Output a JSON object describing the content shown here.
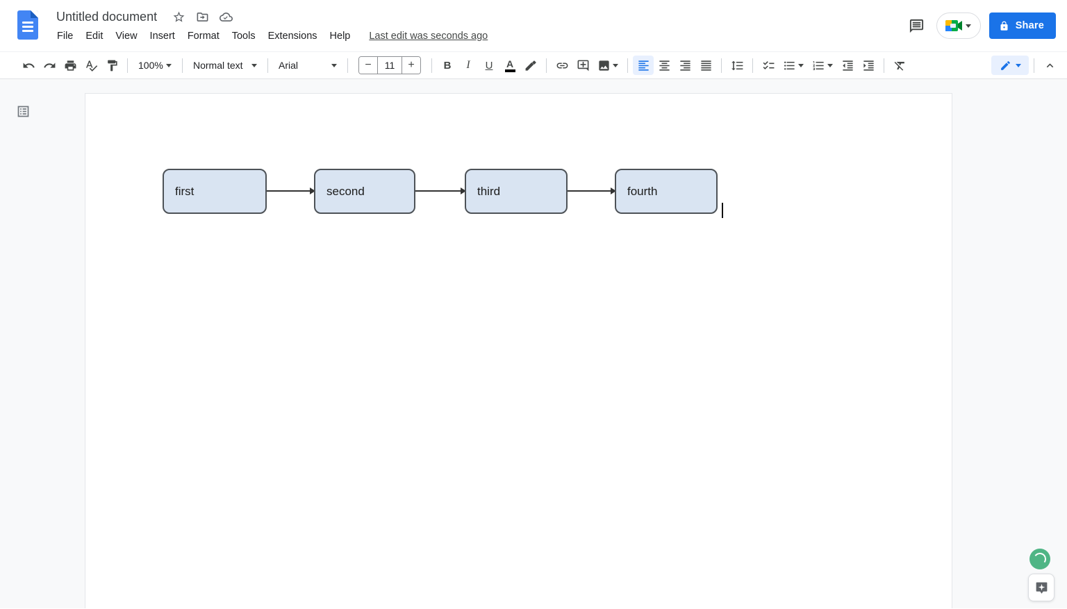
{
  "header": {
    "title": "Untitled document",
    "menu": [
      "File",
      "Edit",
      "View",
      "Insert",
      "Format",
      "Tools",
      "Extensions",
      "Help"
    ],
    "last_edit_status": "Last edit was seconds ago",
    "share_label": "Share"
  },
  "toolbar": {
    "zoom": "100%",
    "paragraph_style": "Normal text",
    "font": "Arial",
    "font_size": "11",
    "bold_glyph": "B",
    "italic_glyph": "I",
    "underline_glyph": "U",
    "text_color_glyph": "A",
    "decrease_font_glyph": "−",
    "increase_font_glyph": "+"
  },
  "document": {
    "drawing_nodes": [
      {
        "label": "first"
      },
      {
        "label": "second"
      },
      {
        "label": "third"
      },
      {
        "label": "fourth"
      }
    ]
  },
  "icons": {
    "docs-logo-icon": "blue document sheet",
    "star-icon": "star outline",
    "move-folder-icon": "folder with arrow",
    "cloud-saved-icon": "cloud with checkmark",
    "comment-history-icon": "speech bubble with lines",
    "meet-icon": "google meet camera",
    "lock-icon": "padlock",
    "undo-icon": "curved arrow left",
    "redo-icon": "curved arrow right",
    "print-icon": "printer",
    "spellcheck-icon": "A with checkmark",
    "paint-format-icon": "paint roller",
    "link-icon": "chain link",
    "add-comment-icon": "bubble with plus",
    "insert-image-icon": "photo",
    "align-left-icon": "left bars (active)",
    "align-center-icon": "centered bars",
    "align-right-icon": "right bars",
    "justify-icon": "full bars",
    "line-spacing-icon": "vertical arrows with lines",
    "checklist-icon": "checks with lines",
    "bulleted-list-icon": "dots with lines",
    "numbered-list-icon": "123 with lines",
    "decrease-indent-icon": "bars arrow left",
    "increase-indent-icon": "bars arrow right",
    "clear-formatting-icon": "A struck through",
    "editing-mode-pencil-icon": "blue pencil",
    "hide-menus-icon": "chevron up",
    "outline-icon": "boxed list",
    "sync-spinner-icon": "green circle arc",
    "explore-icon": "bubble with four-point star"
  },
  "colors": {
    "accent_blue": "#1a73e8",
    "toolbar_icon_gray": "#444746",
    "active_control_bg": "#e8f0fe",
    "canvas_bg": "#f8f9fa",
    "node_fill": "#d9e4f2",
    "node_border": "#4d5257",
    "spinner_green": "#4fb585",
    "text_color_swatch": "#000000"
  }
}
